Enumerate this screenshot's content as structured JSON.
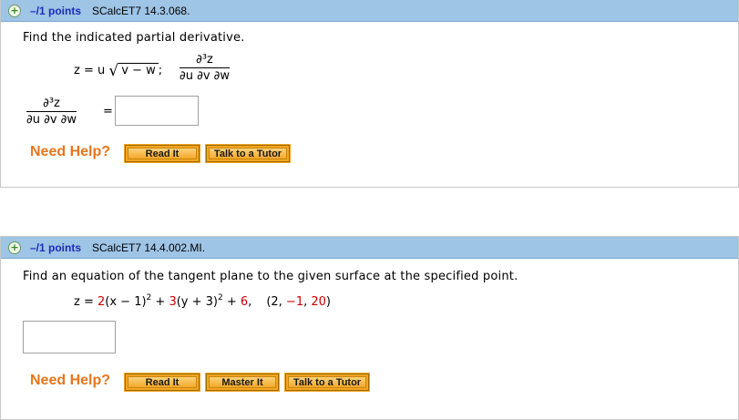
{
  "questions": [
    {
      "points": "–/1 points",
      "id": "SCalcET7 14.3.068.",
      "prompt": "Find the indicated partial derivative.",
      "eq_lhs": "z = u",
      "eq_rad": "v − w",
      "eq_semicolon": ";",
      "frac_num": "∂³z",
      "frac_den": "∂u ∂v ∂w",
      "answer_eq": "=",
      "answer_value": "",
      "need_help": "Need Help?",
      "buttons": [
        "Read It",
        "Talk to a Tutor"
      ]
    },
    {
      "points": "–/1 points",
      "id": "SCalcET7 14.4.002.MI.",
      "prompt": "Find an equation of the tangent plane to the given surface at the specified point.",
      "eq_z": "z = ",
      "eq_parts": [
        "2",
        "(x − 1)",
        "2",
        " + ",
        "3",
        "(y + 3)",
        "2",
        " + ",
        "6",
        ",",
        "(2, ",
        "−1",
        ", ",
        "20",
        ")"
      ],
      "answer_value": "",
      "need_help": "Need Help?",
      "buttons": [
        "Read It",
        "Master It",
        "Talk to a Tutor"
      ]
    }
  ],
  "colors": {
    "header": "#9ec4e6",
    "points": "#1d2db8",
    "help": "#e8751a",
    "button": "#f5a623",
    "value_red": "#cc0000"
  }
}
